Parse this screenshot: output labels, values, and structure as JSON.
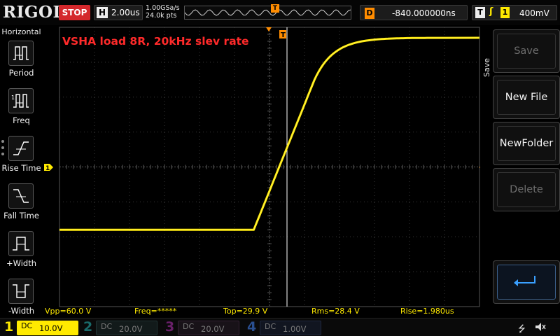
{
  "brand": "RIGOL",
  "run_state": "STOP",
  "horizontal": {
    "letter": "H",
    "timebase": "2.00us",
    "sample_rate": "1.00GSa/s",
    "memory_depth": "24.0k pts"
  },
  "trigger_position_marker": "T",
  "delay": {
    "letter": "D",
    "value": "-840.000000ns"
  },
  "trigger": {
    "letter": "T",
    "edge_icon": "rising-edge-icon",
    "source": "1",
    "level": "400mV"
  },
  "left_menu": {
    "title": "Horizontal",
    "items": [
      {
        "label": "Period",
        "icon": "period-icon"
      },
      {
        "label": "Freq",
        "icon": "freq-icon"
      },
      {
        "label": "Rise Time",
        "icon": "rise-time-icon"
      },
      {
        "label": "Fall Time",
        "icon": "fall-time-icon"
      },
      {
        "label": "+Width",
        "icon": "positive-width-icon"
      },
      {
        "label": "-Width",
        "icon": "negative-width-icon"
      }
    ]
  },
  "annotation": "VSHA load 8R, 20kHz slev rate",
  "right_menu": {
    "title": "Save",
    "buttons": [
      {
        "label": "Save",
        "enabled": false
      },
      {
        "label": "New File",
        "enabled": true
      },
      {
        "label": "NewFolder",
        "enabled": true
      },
      {
        "label": "Delete",
        "enabled": false
      }
    ],
    "return_icon": "return-arrow-icon"
  },
  "measurements": [
    {
      "text": "Vpp=60.0 V"
    },
    {
      "text": "Freq=*****"
    },
    {
      "text": "Top=29.9 V"
    },
    {
      "text": "Rms=28.4 V"
    },
    {
      "text": "Rise=1.980us"
    }
  ],
  "channels": [
    {
      "number": "1",
      "coupling": "DC",
      "scale": "10.0V",
      "color": "#ffea00",
      "active": true
    },
    {
      "number": "2",
      "coupling": "DC",
      "scale": "20.0V",
      "color": "#00c0c0",
      "active": false
    },
    {
      "number": "3",
      "coupling": "DC",
      "scale": "20.0V",
      "color": "#d040d0",
      "active": false
    },
    {
      "number": "4",
      "coupling": "DC",
      "scale": "1.00V",
      "color": "#3a7cff",
      "active": false
    }
  ],
  "waveform": {
    "channel": "1",
    "shape": "rising-edge",
    "low_level_div": -1.8,
    "high_level_div": 3.7,
    "edge_start_div": 0.1,
    "edge_end_div": 4.5,
    "trigger_level_div": 0.0
  },
  "colors": {
    "channel1": "#ffea00",
    "trigger": "#ff8c00",
    "stop": "#d4282c",
    "annotation": "#ff2a2a",
    "grid": "#3a3a3a"
  }
}
